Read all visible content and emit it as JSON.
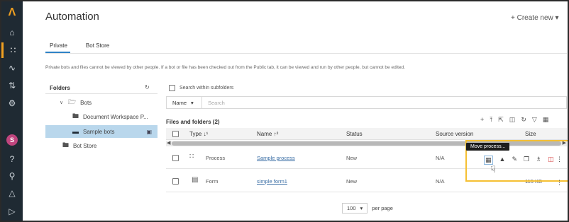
{
  "app": {
    "title": "Automation",
    "create_label": "+ Create new ▾"
  },
  "tabs": [
    {
      "label": "Private"
    },
    {
      "label": "Bot Store"
    }
  ],
  "note": "Private bots and files cannot be viewed by other people. If a bot or file has been checked out from the Public tab, it can be viewed and run by other people, but cannot be edited.",
  "folders": {
    "heading": "Folders",
    "items": [
      {
        "label": "Bots"
      },
      {
        "label": "Document Workspace P..."
      },
      {
        "label": "Sample bots"
      },
      {
        "label": "Bot Store"
      }
    ]
  },
  "search": {
    "subfolders_label": "Search within subfolders",
    "field": "Name",
    "placeholder": "Search"
  },
  "files": {
    "heading": "Files and folders (2)"
  },
  "table": {
    "columns": [
      "Type ↓¹",
      "Name ↑²",
      "Status",
      "Source version",
      "Size"
    ],
    "rows": [
      {
        "type": "Process",
        "name": "Sample process",
        "status": "New",
        "version": "N/A",
        "size": ""
      },
      {
        "type": "Form",
        "name": "simple form1",
        "status": "New",
        "version": "N/A",
        "size": "115 KB"
      }
    ]
  },
  "tooltip": "Move process...",
  "pager": {
    "value": "100",
    "label": "per page"
  },
  "colors": {
    "rail": "#1f2a33",
    "accent": "#f0a021",
    "highlight": "#f5c033",
    "selected": "#b9d7ec",
    "link": "#3a6ea5"
  }
}
